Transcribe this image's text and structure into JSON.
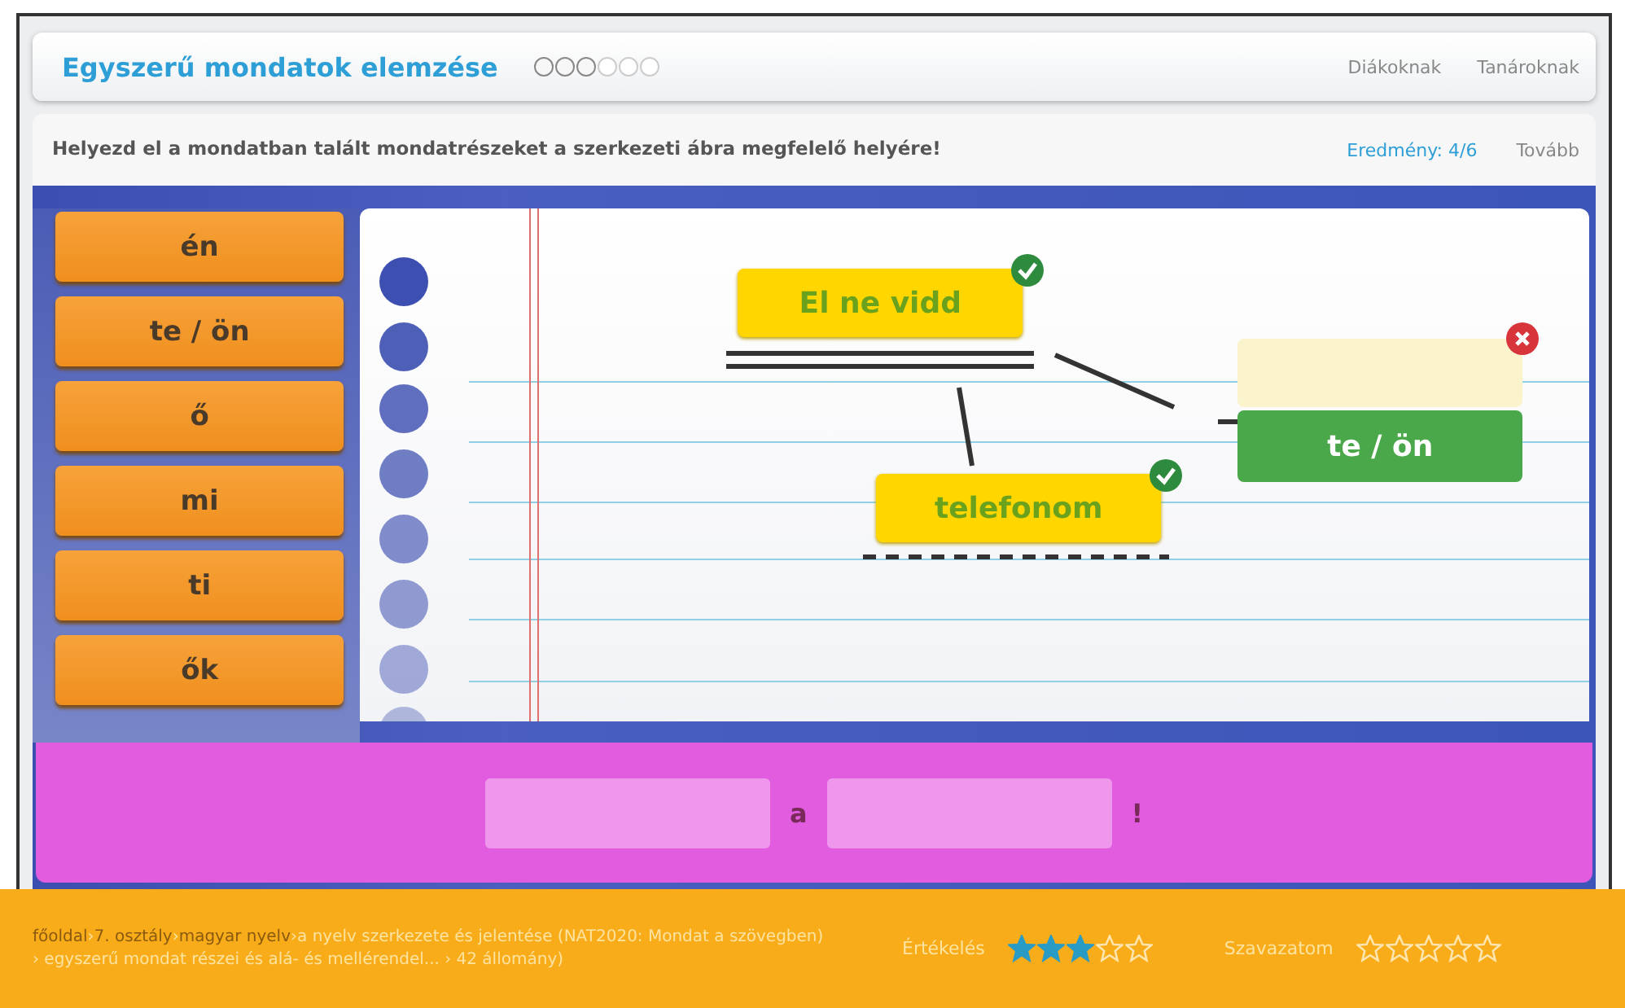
{
  "header": {
    "title": "Egyszerű mondatok elemzése",
    "progress": [
      {
        "done": true
      },
      {
        "done": true
      },
      {
        "done": true
      },
      {
        "done": false
      },
      {
        "done": false
      },
      {
        "done": false
      }
    ],
    "links": [
      "Diákoknak",
      "Tanároknak"
    ]
  },
  "task": {
    "instruction": "Helyezd el a mondatban talált mondatrészeket a szerkezeti ábra megfelelő helyére!",
    "score": "Eredmény: 4/6",
    "next": "Tovább"
  },
  "word_bank": [
    "én",
    "te / ön",
    "ő",
    "mi",
    "ti",
    "ők"
  ],
  "diagram": {
    "slots": [
      {
        "kind": "predicate",
        "text": "El ne vidd",
        "correct": true
      },
      {
        "kind": "object",
        "text": "telefonom",
        "correct": true
      },
      {
        "kind": "subject",
        "correct": false
      }
    ],
    "dragged_card": {
      "text": "te / ön"
    }
  },
  "sentence": [
    {
      "kind": "blank"
    },
    {
      "kind": "word",
      "text": "a"
    },
    {
      "kind": "blank"
    },
    {
      "kind": "word",
      "text": "!"
    }
  ],
  "footer": {
    "breadcrumb": [
      {
        "kind": "link",
        "text": "főoldal"
      },
      {
        "kind": "sep",
        "text": "›"
      },
      {
        "kind": "link",
        "text": "7. osztály"
      },
      {
        "kind": "sep",
        "text": "›"
      },
      {
        "kind": "link",
        "text": "magyar nyelv"
      },
      {
        "kind": "sep",
        "text": "›"
      },
      {
        "kind": "text",
        "text": "a nyelv szerkezete és jelentése (NAT2020: Mondat a szövegben) › egyszerű mondat részei és alá- és mellérendel... › 42 állomány)"
      }
    ],
    "rating": {
      "label": "Értékelés",
      "stars": 3
    },
    "vote": {
      "label": "Szavazatom",
      "stars": 0
    }
  }
}
